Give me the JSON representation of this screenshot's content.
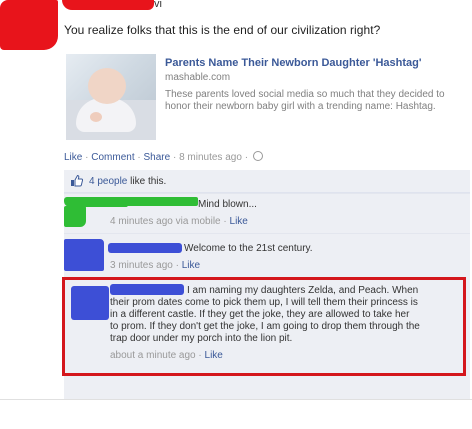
{
  "post": {
    "author_visible_fragment": "vi",
    "status": "You realize folks that this is the end of our civilization right?",
    "link": {
      "title": "Parents Name Their Newborn Daughter 'Hashtag'",
      "domain": "mashable.com",
      "description": "These parents loved social media so much that they decided to honor their newborn baby girl with a trending name: Hashtag."
    },
    "actions": {
      "like": "Like",
      "comment": "Comment",
      "share": "Share",
      "time": "8 minutes ago"
    },
    "likes": {
      "count_label": "4 people",
      "suffix": "like this."
    }
  },
  "comments": [
    {
      "avatar_color": "#2fbd35",
      "text": "Mind blown...",
      "time": "4 minutes ago via mobile",
      "like": "Like"
    },
    {
      "avatar_color": "#3d4fd6",
      "text": "Welcome to the 21st century.",
      "time": "3 minutes ago",
      "like": "Like"
    },
    {
      "avatar_color": "#3d4fd6",
      "text_lines": [
        "I am naming my daughters Zelda, and Peach. When",
        "their prom dates come to pick them up, I will tell them their princess is",
        "in a different castle. If they get the joke, they are allowed to take her",
        "to prom. If they don't get the joke, I am going to drop them through the",
        "trap door under my porch into the lion pit."
      ],
      "time": "about a minute ago",
      "like": "Like"
    }
  ],
  "colors": {
    "redaction_red": "#e8141b",
    "highlight_red": "#d4161c",
    "fb_link": "#3b5998",
    "comment_bg": "#edeff4"
  }
}
